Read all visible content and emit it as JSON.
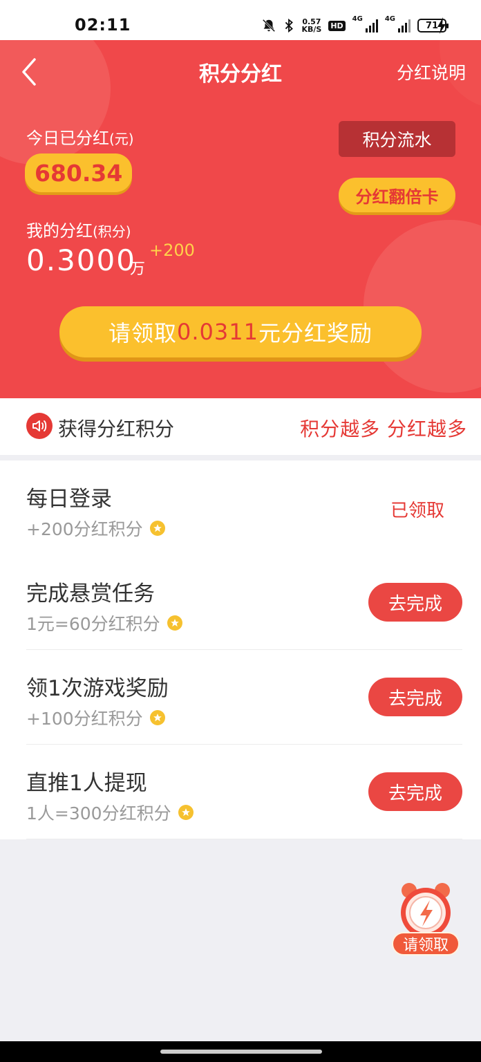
{
  "status_bar": {
    "time": "02:11",
    "net_speed_value": "0.57",
    "net_speed_unit": "KB/S",
    "hd_label": "HD",
    "signal1_label": "4G",
    "signal2_label": "4G",
    "battery_level": "71",
    "icons": [
      "mute-bell-icon",
      "bluetooth-icon",
      "signal-icon",
      "battery-icon",
      "charging-icon"
    ]
  },
  "header": {
    "title": "积分分红",
    "right_link": "分红说明",
    "back_icon": "chevron-left-icon"
  },
  "dividend": {
    "today_label": "今日已分红",
    "today_unit": "(元)",
    "today_value": "680.34",
    "flow_button": "积分流水",
    "double_card_button": "分红翻倍卡",
    "my_label": "我的分红",
    "my_unit_note": "(积分)",
    "my_value": "0.3000",
    "my_value_unit": "万",
    "my_increment": "+200",
    "claim_prefix": "请领取",
    "claim_amount": "0.0311",
    "claim_suffix": "元分红奖励"
  },
  "section": {
    "icon": "speaker-icon",
    "title": "获得分红积分",
    "slogan": "积分越多 分红越多"
  },
  "tasks": [
    {
      "title": "每日登录",
      "subtitle": "+200分红积分",
      "status": "已领取"
    },
    {
      "title": "完成悬赏任务",
      "subtitle": "1元=60分红积分",
      "action": "去完成"
    },
    {
      "title": "领1次游戏奖励",
      "subtitle": "+100分红积分",
      "action": "去完成"
    },
    {
      "title": "直推1人提现",
      "subtitle": "1人=300分红积分",
      "action": "去完成"
    }
  ],
  "floating": {
    "label": "请领取",
    "icon": "alarm-clock-icon"
  },
  "colors": {
    "primary_red": "#f0484a",
    "gold": "#fbc02d",
    "button_red": "#ea4743"
  }
}
